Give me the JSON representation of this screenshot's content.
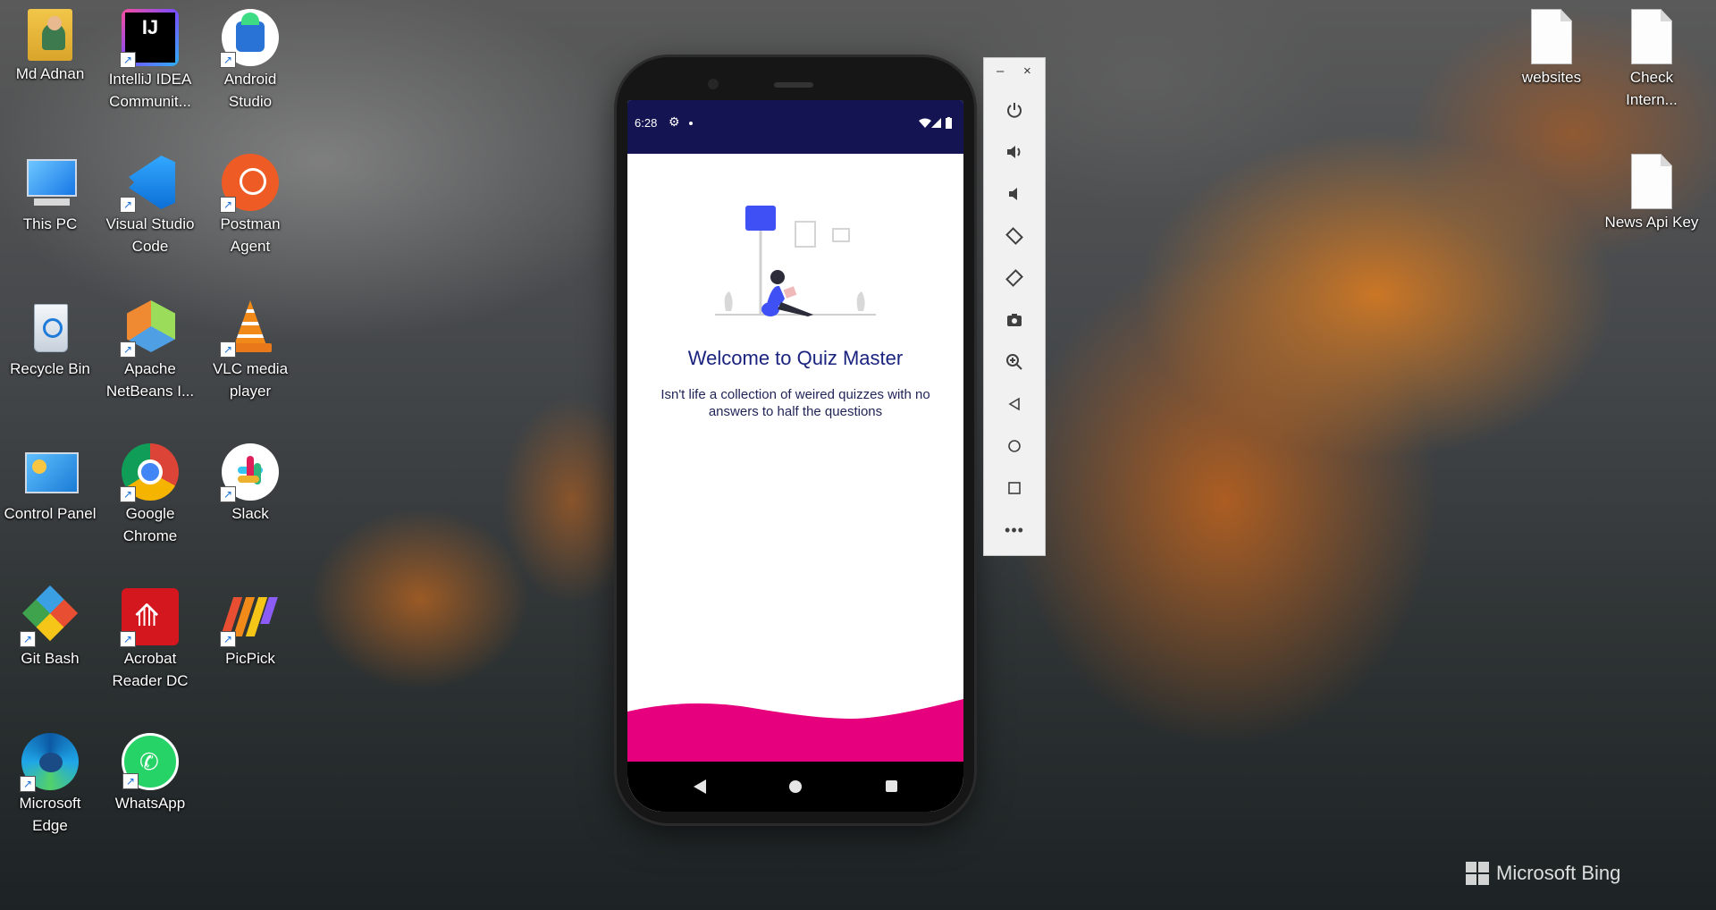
{
  "desktop": {
    "icons_left": [
      {
        "label": "Md Adnan",
        "icon": "user-folder-icon"
      },
      {
        "label": "IntelliJ IDEA Communit...",
        "icon": "intellij-icon"
      },
      {
        "label": "Android Studio",
        "icon": "android-studio-icon"
      },
      {
        "label": "This PC",
        "icon": "this-pc-icon"
      },
      {
        "label": "Visual Studio Code",
        "icon": "vscode-icon"
      },
      {
        "label": "Postman Agent",
        "icon": "postman-icon"
      },
      {
        "label": "Recycle Bin",
        "icon": "recycle-bin-icon"
      },
      {
        "label": "Apache NetBeans I...",
        "icon": "netbeans-icon"
      },
      {
        "label": "VLC media player",
        "icon": "vlc-icon"
      },
      {
        "label": "Control Panel",
        "icon": "control-panel-icon"
      },
      {
        "label": "Google Chrome",
        "icon": "chrome-icon"
      },
      {
        "label": "Slack",
        "icon": "slack-icon"
      },
      {
        "label": "Git Bash",
        "icon": "git-bash-icon"
      },
      {
        "label": "Acrobat Reader DC",
        "icon": "acrobat-icon"
      },
      {
        "label": "PicPick",
        "icon": "picpick-icon"
      },
      {
        "label": "Microsoft Edge",
        "icon": "edge-icon"
      },
      {
        "label": "WhatsApp",
        "icon": "whatsapp-icon"
      }
    ],
    "icons_right": [
      {
        "label": "websites",
        "icon": "text-file-icon"
      },
      {
        "label": "Check Intern...",
        "icon": "text-file-icon"
      },
      {
        "label": "News Api Key",
        "icon": "text-file-icon"
      }
    ],
    "watermark": "Microsoft Bing"
  },
  "phone": {
    "status_time": "6:28",
    "welcome_title": "Welcome to Quiz Master",
    "tagline": "Isn't life a collection of weired quizzes with no answers to half the questions",
    "accent_color": "#e6007e",
    "statusbar_color": "#141453"
  },
  "emulator_panel": {
    "minimize": "–",
    "close": "×",
    "buttons": [
      "power",
      "volume-up",
      "volume-down",
      "rotate-left",
      "rotate-right",
      "screenshot",
      "zoom",
      "back",
      "home",
      "overview",
      "more"
    ]
  }
}
